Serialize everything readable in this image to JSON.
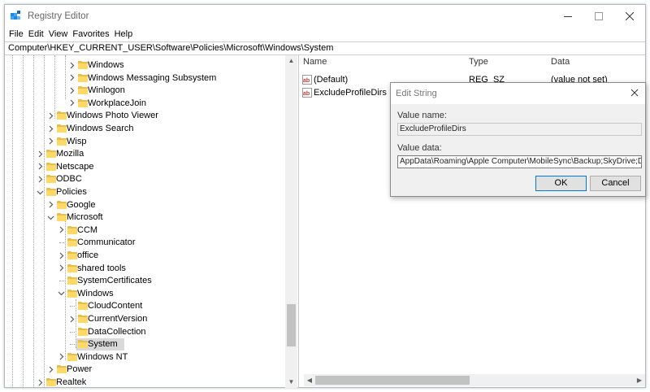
{
  "window": {
    "title": "Registry Editor"
  },
  "menu": [
    "File",
    "Edit",
    "View",
    "Favorites",
    "Help"
  ],
  "address": "Computer\\HKEY_CURRENT_USER\\Software\\Policies\\Microsoft\\Windows\\System",
  "tree": [
    {
      "label": "Windows",
      "level": 4,
      "expander": "collapsed"
    },
    {
      "label": "Windows Messaging Subsystem",
      "level": 4,
      "expander": "collapsed"
    },
    {
      "label": "Winlogon",
      "level": 4,
      "expander": "collapsed"
    },
    {
      "label": "WorkplaceJoin",
      "level": 4,
      "expander": "collapsed"
    },
    {
      "label": "Windows Photo Viewer",
      "level": 2,
      "expander": "collapsed"
    },
    {
      "label": "Windows Search",
      "level": 2,
      "expander": "collapsed"
    },
    {
      "label": "Wisp",
      "level": 2,
      "expander": "collapsed"
    },
    {
      "label": "Mozilla",
      "level": 1,
      "expander": "collapsed"
    },
    {
      "label": "Netscape",
      "level": 1,
      "expander": "collapsed"
    },
    {
      "label": "ODBC",
      "level": 1,
      "expander": "collapsed"
    },
    {
      "label": "Policies",
      "level": 1,
      "expander": "expanded"
    },
    {
      "label": "Google",
      "level": 2,
      "expander": "collapsed"
    },
    {
      "label": "Microsoft",
      "level": 2,
      "expander": "expanded"
    },
    {
      "label": "CCM",
      "level": 3,
      "expander": "collapsed"
    },
    {
      "label": "Communicator",
      "level": 3,
      "expander": "none"
    },
    {
      "label": "office",
      "level": 3,
      "expander": "collapsed"
    },
    {
      "label": "shared tools",
      "level": 3,
      "expander": "collapsed"
    },
    {
      "label": "SystemCertificates",
      "level": 3,
      "expander": "none"
    },
    {
      "label": "Windows",
      "level": 3,
      "expander": "expanded"
    },
    {
      "label": "CloudContent",
      "level": 4,
      "expander": "none"
    },
    {
      "label": "CurrentVersion",
      "level": 4,
      "expander": "collapsed"
    },
    {
      "label": "DataCollection",
      "level": 4,
      "expander": "none"
    },
    {
      "label": "System",
      "level": 4,
      "expander": "none",
      "selected": true
    },
    {
      "label": "Windows NT",
      "level": 3,
      "expander": "collapsed"
    },
    {
      "label": "Power",
      "level": 2,
      "expander": "collapsed"
    },
    {
      "label": "Realtek",
      "level": 1,
      "expander": "collapsed"
    }
  ],
  "list": {
    "headers": {
      "name": "Name",
      "type": "Type",
      "data": "Data"
    },
    "rows": [
      {
        "name": "(Default)",
        "type": "REG_SZ",
        "data": "(value not set)"
      },
      {
        "name": "ExcludeProfileDirs",
        "type": "",
        "data": ""
      }
    ]
  },
  "dialog": {
    "title": "Edit String",
    "value_name_label": "Value name:",
    "value_name": "ExcludeProfileDirs",
    "value_data_label": "Value data:",
    "value_data": "AppData\\Roaming\\Apple Computer\\MobileSync\\Backup;SkyDrive;Dropbox;A",
    "ok_label": "OK",
    "cancel_label": "Cancel"
  },
  "colors": {
    "folder": "#ffd966",
    "selection": "#d9d9d9",
    "accent": "#0078d7"
  }
}
